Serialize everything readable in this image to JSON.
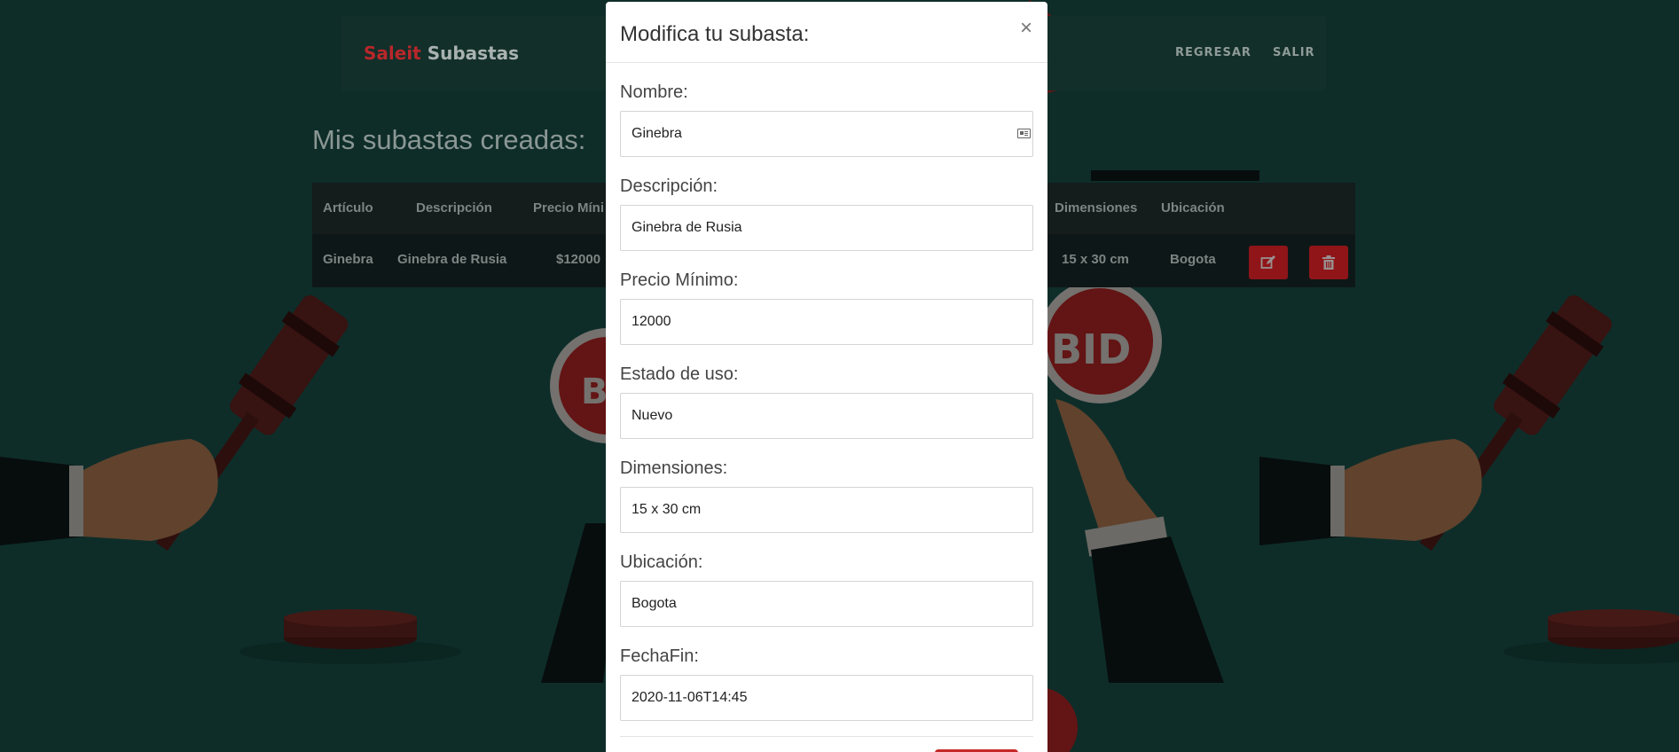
{
  "brand": {
    "part1": "Saleit",
    "part2": "Subastas"
  },
  "nav": {
    "back": "REGRESAR",
    "logout": "SALIR"
  },
  "page_title": "Mis subastas creadas:",
  "table": {
    "headers": [
      "Artículo",
      "Descripción",
      "Precio Míni",
      "Dimensiones",
      "Ubicación"
    ],
    "row": {
      "articulo": "Ginebra",
      "descripcion": "Ginebra de Rusia",
      "precio": "$12000",
      "dimensiones": "15 x 30 cm",
      "ubicacion": "Bogota"
    }
  },
  "modal": {
    "title": "Modifica tu subasta:",
    "close": "×",
    "fields": {
      "nombre": {
        "label": "Nombre:",
        "value": "Ginebra"
      },
      "descripcion": {
        "label": "Descripción:",
        "value": "Ginebra de Rusia"
      },
      "precio": {
        "label": "Precio Mínimo:",
        "value": "12000"
      },
      "estado": {
        "label": "Estado de uso:",
        "value": "Nuevo"
      },
      "dimensiones": {
        "label": "Dimensiones:",
        "value": "15 x 30 cm"
      },
      "ubicacion": {
        "label": "Ubicación:",
        "value": "Bogota"
      },
      "fechafin": {
        "label": "FechaFin:",
        "value": "2020-11-06T14:45"
      }
    }
  },
  "background_image": {
    "paddle_text": "BID"
  },
  "colors": {
    "brand_red": "#b8272a",
    "teal_bg": "#1d5a52",
    "danger": "#c62828"
  }
}
